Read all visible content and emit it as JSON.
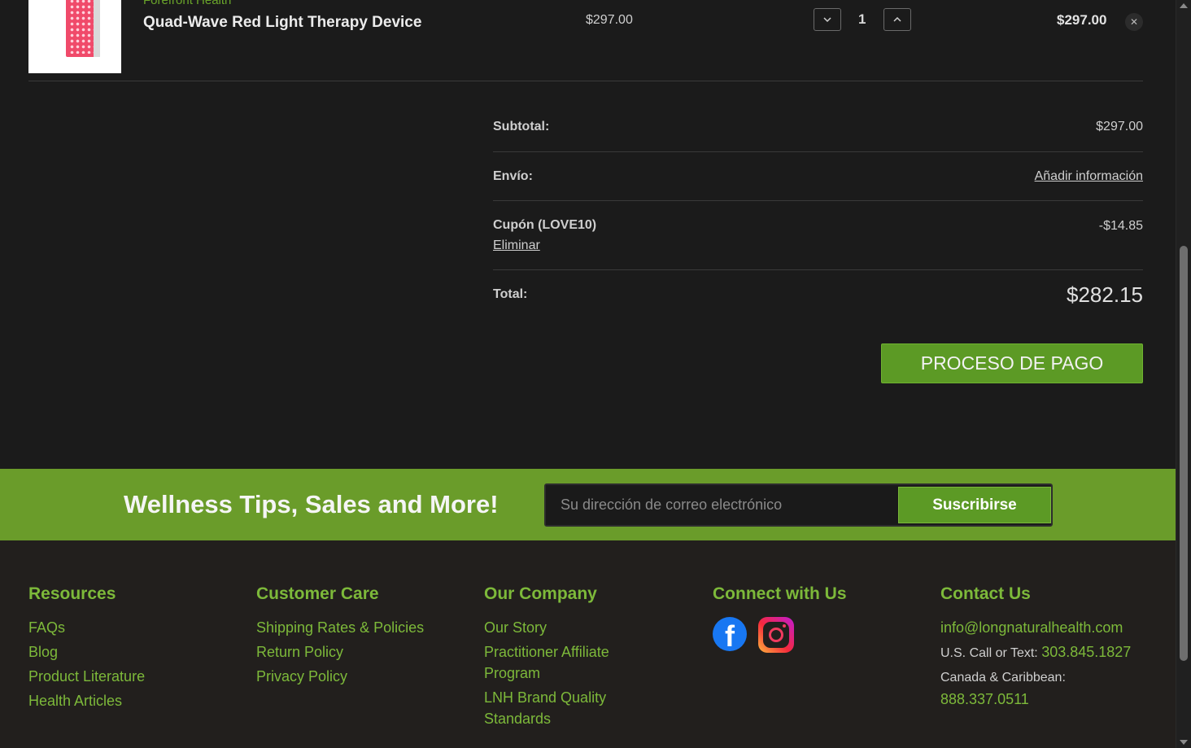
{
  "cart_item": {
    "brand": "Forefront Health",
    "name": "Quad-Wave Red Light Therapy Device",
    "unit_price": "$297.00",
    "quantity": "1",
    "line_total": "$297.00",
    "qty_decrease_icon": "chevron-down-icon",
    "qty_increase_icon": "chevron-up-icon",
    "remove_icon": "close-icon",
    "remove_glyph": "✕"
  },
  "totals": {
    "subtotal_label": "Subtotal:",
    "subtotal_value": "$297.00",
    "shipping_label": "Envío:",
    "shipping_value": "Añadir información",
    "coupon_label": "Cupón (LOVE10)",
    "coupon_remove": "Eliminar",
    "coupon_value": "-$14.85",
    "total_label": "Total:",
    "total_value": "$282.15"
  },
  "checkout_button": "PROCESO DE PAGO",
  "newsletter": {
    "title": "Wellness Tips, Sales and More!",
    "placeholder": "Su dirección de correo electrónico",
    "button": "Suscribirse"
  },
  "footer": {
    "resources": {
      "heading": "Resources",
      "links": [
        "FAQs",
        "Blog",
        "Product Literature",
        "Health Articles"
      ]
    },
    "customer_care": {
      "heading": "Customer Care",
      "links": [
        "Shipping Rates & Policies",
        "Return Policy",
        "Privacy Policy"
      ]
    },
    "our_company": {
      "heading": "Our Company",
      "links": [
        "Our Story",
        "Practitioner Affiliate Program",
        "LNH Brand Quality Standards"
      ]
    },
    "connect": {
      "heading": "Connect with Us",
      "icons": [
        "facebook-icon",
        "instagram-icon"
      ]
    },
    "contact": {
      "heading": "Contact Us",
      "email": "info@longnaturalhealth.com",
      "us_label": "U.S. Call or Text:",
      "us_phone": "303.845.1827",
      "canada_label": "Canada & Caribbean:",
      "canada_phone": "888.337.0511"
    }
  },
  "colors": {
    "accent_green": "#6a9c2a",
    "link_green": "#7db93a",
    "background": "#1b1b1b"
  }
}
